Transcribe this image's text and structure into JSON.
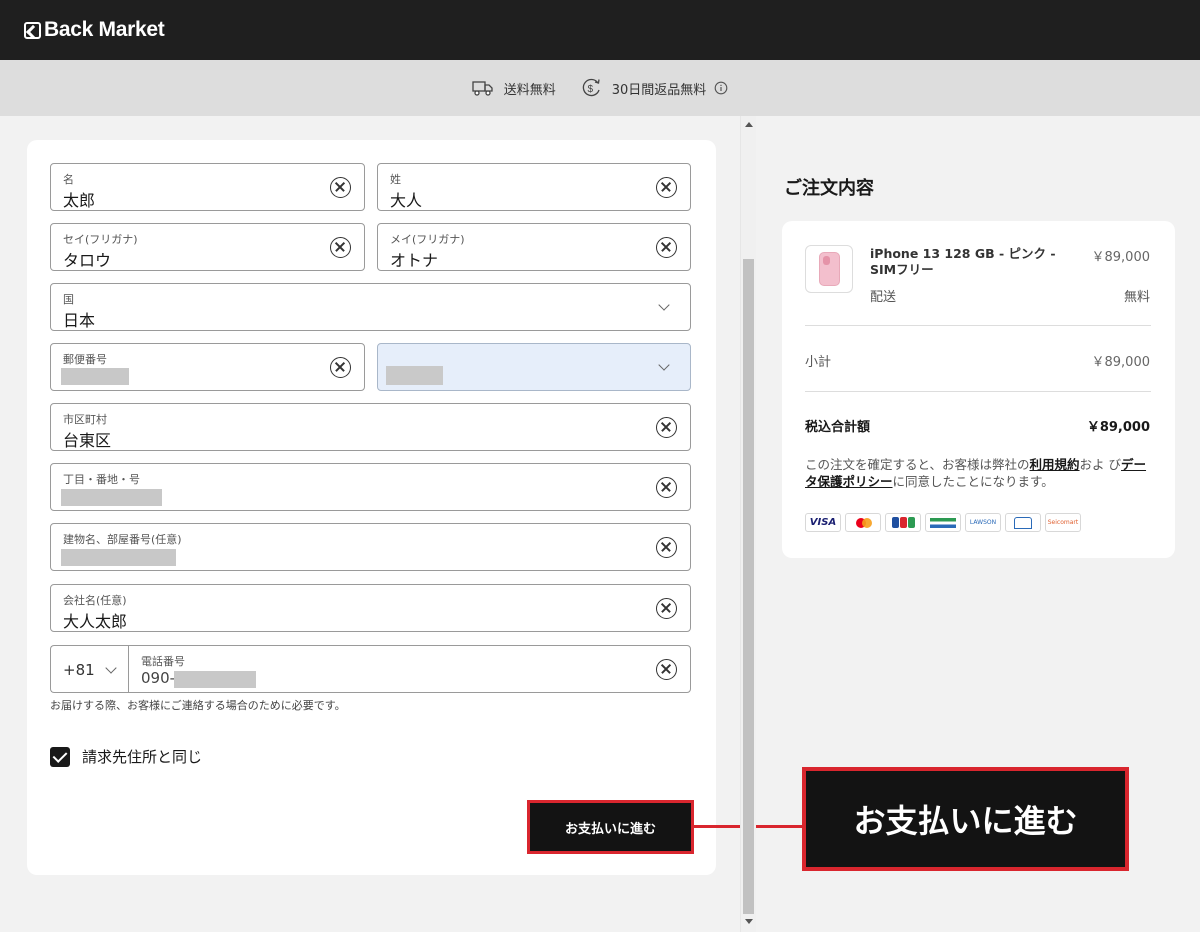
{
  "header": {
    "brand": "Back Market"
  },
  "benefits": [
    {
      "icon": "truck-icon",
      "label": "送料無料"
    },
    {
      "icon": "refund-coin-icon",
      "label": "30日間返品無料"
    }
  ],
  "form": {
    "first_name": {
      "label": "名",
      "value": "太郎"
    },
    "last_name": {
      "label": "姓",
      "value": "大人"
    },
    "first_name_kana": {
      "label": "セイ(フリガナ)",
      "value": "タロウ"
    },
    "last_name_kana": {
      "label": "メイ(フリガナ)",
      "value": "オトナ"
    },
    "country": {
      "label": "国",
      "value": "日本"
    },
    "postal_code": {
      "label": "郵便番号",
      "value": ""
    },
    "prefecture": {
      "label": "",
      "value": ""
    },
    "city": {
      "label": "市区町村",
      "value": "台東区"
    },
    "street": {
      "label": "丁目・番地・号",
      "value": ""
    },
    "building": {
      "label": "建物名、部屋番号(任意)",
      "value": ""
    },
    "company": {
      "label": "会社名(任意)",
      "value": "大人太郎"
    },
    "phone_prefix": "+81",
    "phone": {
      "label": "電話番号",
      "value": "090-"
    },
    "phone_hint": "お届けする際、お客様にご連絡する場合のために必要です。",
    "billing_same_label": "請求先住所と同じ",
    "billing_same_checked": true,
    "submit_label": "お支払いに進む"
  },
  "callout": {
    "label": "お支払いに進む",
    "accent": "#d9262e"
  },
  "summary": {
    "title": "ご注文内容",
    "product_name": "iPhone 13 128 GB - ピンク - SIMフリー",
    "product_price": "￥89,000",
    "shipping_label": "配送",
    "shipping_value": "無料",
    "subtotal_label": "小計",
    "subtotal_value": "￥89,000",
    "total_label": "税込合計額",
    "total_value": "￥89,000",
    "legal_1": "この注文を確定すると、お客様は弊社の",
    "terms_link": "利用規約",
    "legal_2": "およ び",
    "privacy_link": "データ保護ポリシー",
    "legal_3": "に同意したことになります。",
    "payment_methods": [
      "VISA",
      "Mastercard",
      "JCB",
      "FamilyMart",
      "LAWSON",
      "MINISTOP",
      "Seicomart"
    ],
    "visa_text": "VISA",
    "lawson_text": "LAWSON",
    "seicomart_text": "Seicomart"
  }
}
